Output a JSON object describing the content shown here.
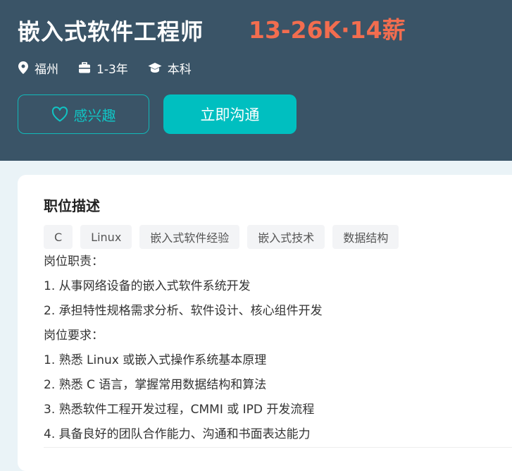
{
  "job": {
    "title": "嵌入式软件工程师",
    "salary": "13-26K·14薪",
    "location": "福州",
    "experience": "1-3年",
    "education": "本科"
  },
  "actions": {
    "interest_label": "感兴趣",
    "chat_label": "立即沟通"
  },
  "description": {
    "heading": "职位描述",
    "tags": [
      "C",
      "Linux",
      "嵌入式软件经验",
      "嵌入式技术",
      "数据结构"
    ],
    "lines": [
      "岗位职责：",
      "1. 从事网络设备的嵌入式软件系统开发",
      "2. 承担特性规格需求分析、软件设计、核心组件开发",
      "岗位要求：",
      "1. 熟悉 Linux 或嵌入式操作系统基本原理",
      "2. 熟悉 C 语言，掌握常用数据结构和算法",
      "3. 熟悉软件工程开发过程，CMMI 或 IPD 开发流程",
      "4. 具备良好的团队合作能力、沟通和书面表达能力"
    ]
  },
  "colors": {
    "header_bg": "#3a5467",
    "salary": "#f26d4f",
    "accent": "#00bfc0"
  },
  "icons": {
    "location": "location-pin-icon",
    "experience": "briefcase-icon",
    "education": "graduation-cap-icon",
    "interest": "heart-icon"
  }
}
